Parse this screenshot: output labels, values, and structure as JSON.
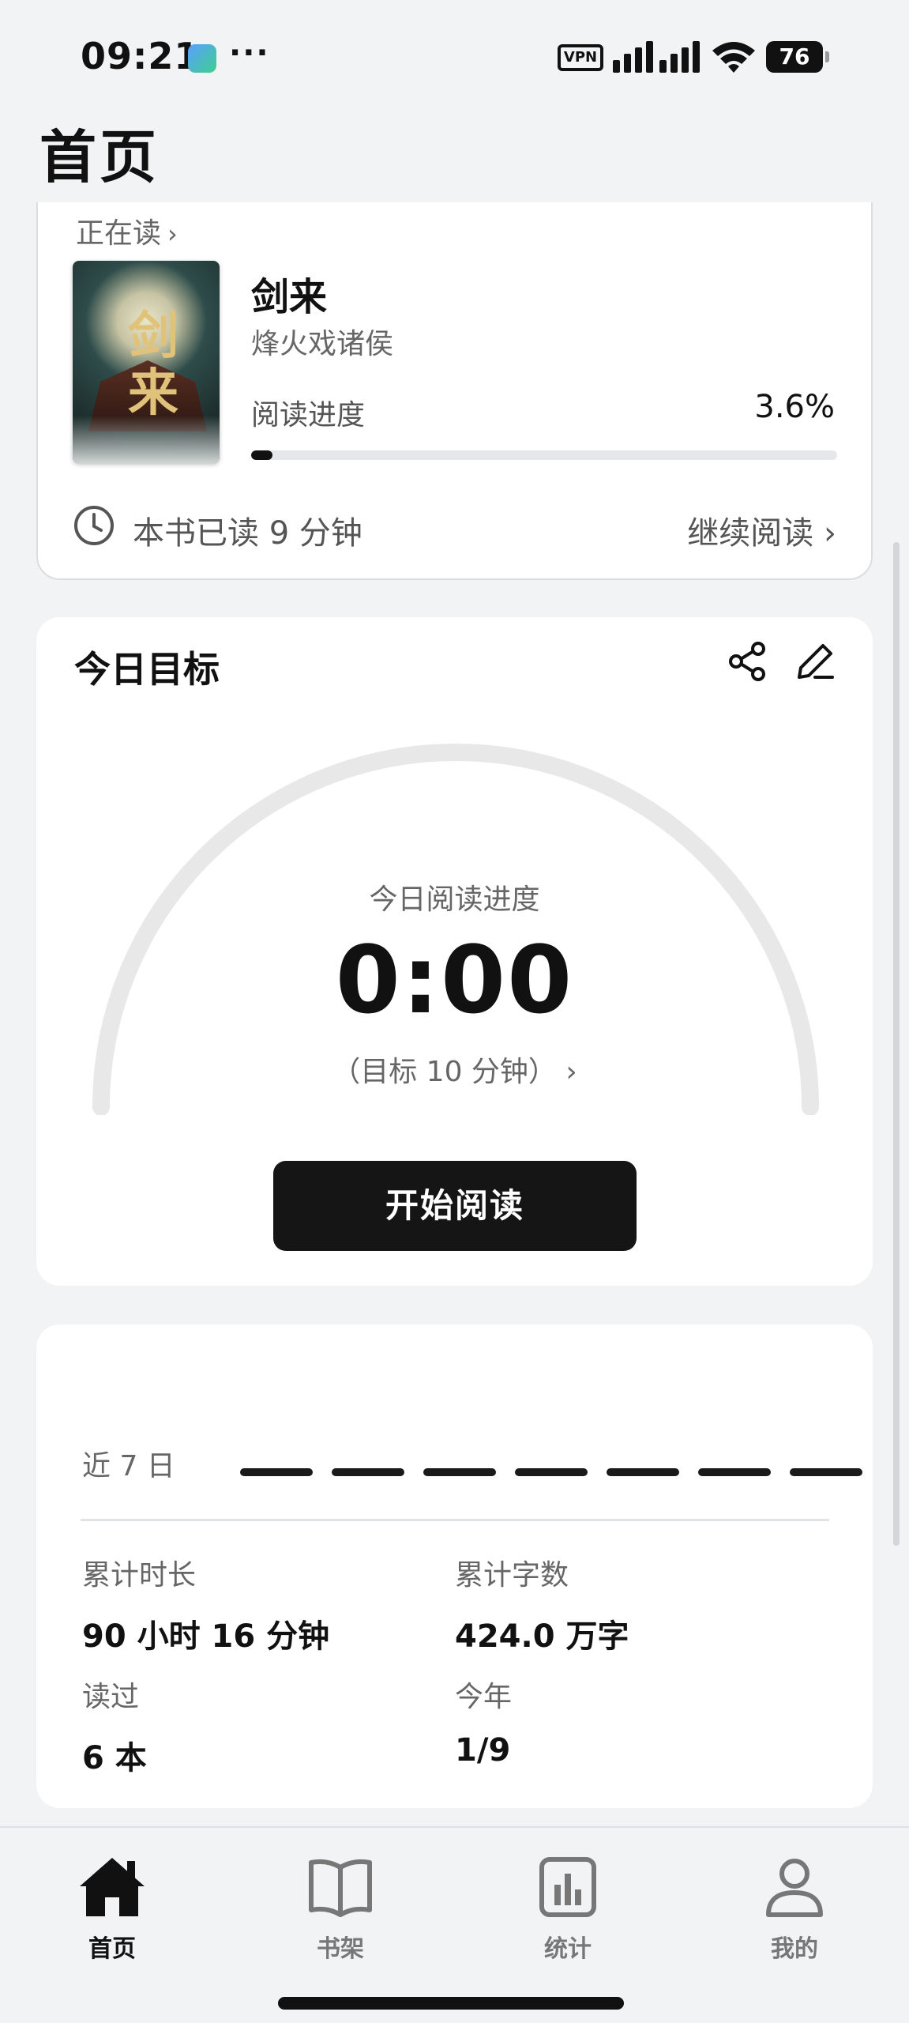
{
  "status_bar": {
    "time": "09:21",
    "more": "···",
    "vpn": "VPN",
    "battery": "76"
  },
  "page": {
    "title": "首页"
  },
  "current_book": {
    "section_label": "正在读",
    "title": "剑来",
    "author": "烽火戏诸侯",
    "progress_label": "阅读进度",
    "progress_value": "3.6%",
    "progress_fraction": 0.036,
    "time_read": "本书已读 9 分钟",
    "continue_label": "继续阅读"
  },
  "daily_goal": {
    "title": "今日目标",
    "gauge_label": "今日阅读进度",
    "gauge_value": "0:00",
    "target_text": "（目标 10 分钟）",
    "start_button": "开始阅读"
  },
  "stats": {
    "week_label": "近 7 日",
    "week_days": 7,
    "total_time_label": "累计时长",
    "total_time_value": "90 小时 16 分钟",
    "total_words_label": "累计字数",
    "total_words_value": "424.0 万字",
    "books_read_label": "读过",
    "books_read_value": "6 本",
    "this_year_label": "今年",
    "this_year_value": "1/9"
  },
  "nav": {
    "items": [
      {
        "label": "首页",
        "icon": "home-icon",
        "active": true
      },
      {
        "label": "书架",
        "icon": "book-open-icon",
        "active": false
      },
      {
        "label": "统计",
        "icon": "chart-icon",
        "active": false
      },
      {
        "label": "我的",
        "icon": "user-icon",
        "active": false
      }
    ]
  }
}
